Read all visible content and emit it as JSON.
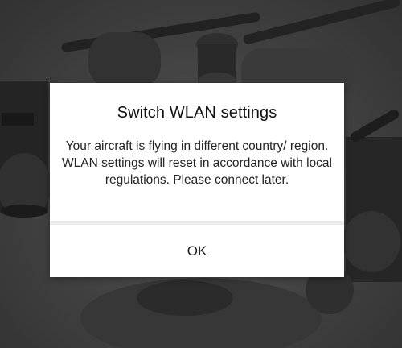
{
  "dialog": {
    "title": "Switch WLAN settings",
    "message": "Your aircraft is flying in different country/ region. WLAN settings will reset in accordance with local regulations. Please connect later.",
    "ok_label": "OK"
  },
  "background": {
    "subject": "drone",
    "icon": "drone-image"
  }
}
